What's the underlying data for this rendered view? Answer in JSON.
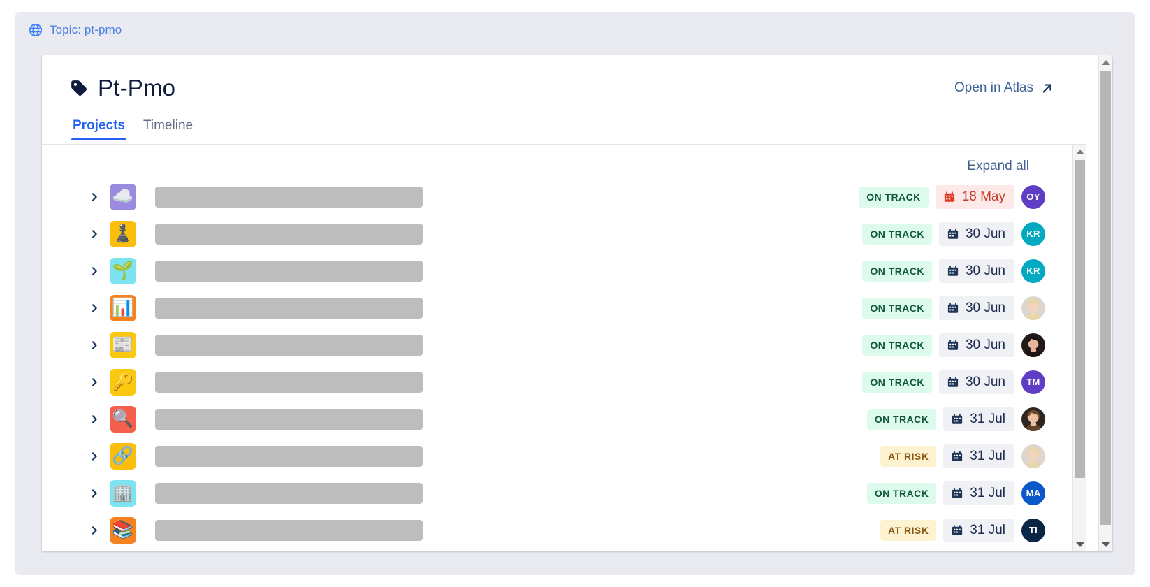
{
  "topic": {
    "icon": "globe-icon",
    "label": "Topic: pt-pmo"
  },
  "header": {
    "icon": "tag-icon",
    "title": "Pt-Pmo",
    "open_link_label": "Open in Atlas",
    "open_link_icon": "external-link-arrow-icon"
  },
  "tabs": [
    {
      "label": "Projects",
      "active": true
    },
    {
      "label": "Timeline",
      "active": false
    }
  ],
  "toolbar": {
    "expand_all_label": "Expand all"
  },
  "colors": {
    "accent": "#2660f5",
    "topic_text": "#4c7fe8",
    "title": "#0f1b3d",
    "link": "#3d6399",
    "on_track_bg": "#ddfbec",
    "on_track_text": "#10563a",
    "at_risk_bg": "#fdf3d0",
    "at_risk_text": "#8a5510",
    "date_bg": "#f0f1f4",
    "date_text": "#1b2a4e",
    "overdue_bg": "#fdeae8",
    "overdue_text": "#c43a28",
    "panel_bg": "#e9ebf0",
    "name_placeholder": "#bdbdbd"
  },
  "projects": [
    {
      "chevron": "chevron-right-icon",
      "icon": "cloud-icon",
      "icon_glyph": "☁️",
      "icon_bg": "#9a8be0",
      "name": "",
      "status": "ON TRACK",
      "status_type": "ontrack",
      "date": "18 May",
      "date_type": "overdue",
      "avatar_initials": "OY",
      "avatar_bg": "#5f3dc4",
      "avatar_type": "initials"
    },
    {
      "chevron": "chevron-right-icon",
      "icon": "chess-pawn-icon",
      "icon_glyph": "♟️",
      "icon_bg": "#fcbe0c",
      "name": "",
      "status": "ON TRACK",
      "status_type": "ontrack",
      "date": "30 Jun",
      "date_type": "normal",
      "avatar_initials": "KR",
      "avatar_bg": "#03a9c0",
      "avatar_type": "initials"
    },
    {
      "chevron": "chevron-right-icon",
      "icon": "seedling-icon",
      "icon_glyph": "🌱",
      "icon_bg": "#7ce3f0",
      "name": "",
      "status": "ON TRACK",
      "status_type": "ontrack",
      "date": "30 Jun",
      "date_type": "normal",
      "avatar_initials": "KR",
      "avatar_bg": "#03a9c0",
      "avatar_type": "initials"
    },
    {
      "chevron": "chevron-right-icon",
      "icon": "bar-chart-icon",
      "icon_glyph": "📊",
      "icon_bg": "#f58221",
      "name": "",
      "status": "ON TRACK",
      "status_type": "ontrack",
      "date": "30 Jun",
      "date_type": "normal",
      "avatar_initials": "",
      "avatar_bg": "#efd9c8",
      "avatar_type": "photo-blonde"
    },
    {
      "chevron": "chevron-right-icon",
      "icon": "newspaper-icon",
      "icon_glyph": "📰",
      "icon_bg": "#fcc80f",
      "name": "",
      "status": "ON TRACK",
      "status_type": "ontrack",
      "date": "30 Jun",
      "date_type": "normal",
      "avatar_initials": "",
      "avatar_bg": "#2b1d1a",
      "avatar_type": "photo-dark"
    },
    {
      "chevron": "chevron-right-icon",
      "icon": "key-icon",
      "icon_glyph": "🔑",
      "icon_bg": "#fcc80f",
      "name": "",
      "status": "ON TRACK",
      "status_type": "ontrack",
      "date": "30 Jun",
      "date_type": "normal",
      "avatar_initials": "TM",
      "avatar_bg": "#5f3dc4",
      "avatar_type": "initials"
    },
    {
      "chevron": "chevron-right-icon",
      "icon": "magnifying-glass-icon",
      "icon_glyph": "🔍",
      "icon_bg": "#f4604c",
      "name": "",
      "status": "ON TRACK",
      "status_type": "ontrack",
      "date": "31 Jul",
      "date_type": "normal",
      "avatar_initials": "",
      "avatar_bg": "#3b2a22",
      "avatar_type": "photo-brown"
    },
    {
      "chevron": "chevron-right-icon",
      "icon": "link-icon",
      "icon_glyph": "🔗",
      "icon_bg": "#fcbe0c",
      "name": "",
      "status": "AT RISK",
      "status_type": "atrisk",
      "date": "31 Jul",
      "date_type": "normal",
      "avatar_initials": "",
      "avatar_bg": "#e8d6c6",
      "avatar_type": "photo-blonde"
    },
    {
      "chevron": "chevron-right-icon",
      "icon": "office-clock-icon",
      "icon_glyph": "🏢",
      "icon_bg": "#7ce3f0",
      "name": "",
      "status": "ON TRACK",
      "status_type": "ontrack",
      "date": "31 Jul",
      "date_type": "normal",
      "avatar_initials": "MA",
      "avatar_bg": "#0a58ca",
      "avatar_type": "initials"
    },
    {
      "chevron": "chevron-right-icon",
      "icon": "books-icon",
      "icon_glyph": "📚",
      "icon_bg": "#f58221",
      "name": "",
      "status": "AT RISK",
      "status_type": "atrisk",
      "date": "31 Jul",
      "date_type": "normal",
      "avatar_initials": "TI",
      "avatar_bg": "#0b2545",
      "avatar_type": "initials"
    }
  ],
  "scrollbars": {
    "inner": {
      "up_icon": "scroll-up-arrow-icon",
      "down_icon": "scroll-down-arrow-icon"
    },
    "outer": {
      "up_icon": "scroll-up-arrow-icon",
      "down_icon": "scroll-down-arrow-icon"
    }
  }
}
